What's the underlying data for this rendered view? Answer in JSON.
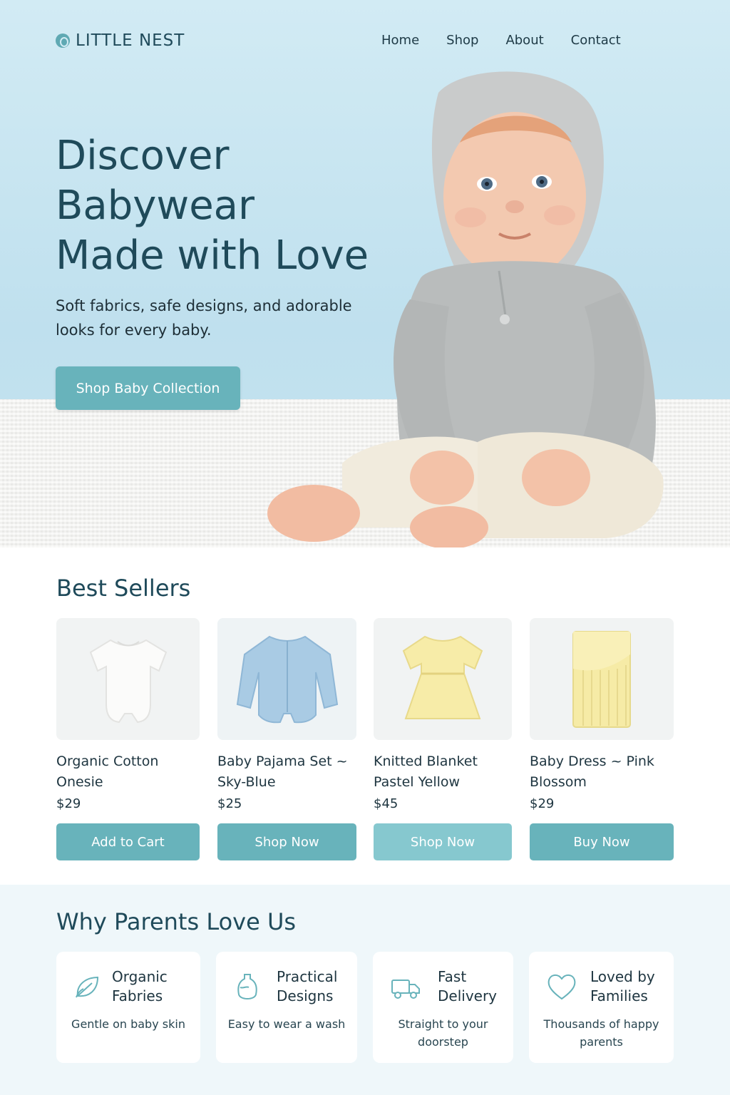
{
  "brand": {
    "name": "LITTLE NEST",
    "icon": "logo-mark"
  },
  "nav": {
    "items": [
      "Home",
      "Shop",
      "About",
      "Contact"
    ]
  },
  "hero": {
    "title_lines": [
      "Discover",
      "Babywear",
      "Made with Love"
    ],
    "subtitle_lines": [
      "Soft fabrics, safe designs, and adorable",
      "looks for every baby."
    ],
    "cta": "Shop Baby Collection"
  },
  "best_sellers": {
    "title": "Best Sellers",
    "products": [
      {
        "name_lines": [
          "Organic Cotton",
          "Onesie"
        ],
        "price": "$29",
        "button": "Add to Cart",
        "image": "white-onesie"
      },
      {
        "name_lines": [
          "Baby Pajama Set ~",
          "Sky-Blue"
        ],
        "price": "$25",
        "button": "Shop Now",
        "image": "blue-pajama"
      },
      {
        "name_lines": [
          "Knitted Blanket",
          "Pastel Yellow"
        ],
        "price": "$45",
        "button": "Shop Now",
        "image": "yellow-dress"
      },
      {
        "name_lines": [
          "Baby Dress ~ Pink",
          "Blossom"
        ],
        "price": "$29",
        "button": "Buy Now",
        "image": "yellow-blanket"
      }
    ]
  },
  "why": {
    "title": "Why Parents Love Us",
    "features": [
      {
        "title_lines": [
          "Organic",
          "Fabries"
        ],
        "desc_lines": [
          "Gentle on baby skin"
        ],
        "icon": "leaf-icon"
      },
      {
        "title_lines": [
          "Practical",
          "Designs"
        ],
        "desc_lines": [
          "Easy to wear a wash"
        ],
        "icon": "bottle-icon"
      },
      {
        "title_lines": [
          "Fast",
          "Delivery"
        ],
        "desc_lines": [
          "Straight to your",
          "doorstep"
        ],
        "icon": "truck-icon"
      },
      {
        "title_lines": [
          "Loved by",
          "Families"
        ],
        "desc_lines": [
          "Thousands of happy",
          "parents"
        ],
        "icon": "heart-icon"
      }
    ]
  },
  "colors": {
    "accent": "#68b3bb",
    "accent_light": "#86c8cf",
    "heading": "#1f4a5a",
    "hero_bg": "#c6e4f0",
    "band_bg": "#eff7fa"
  }
}
